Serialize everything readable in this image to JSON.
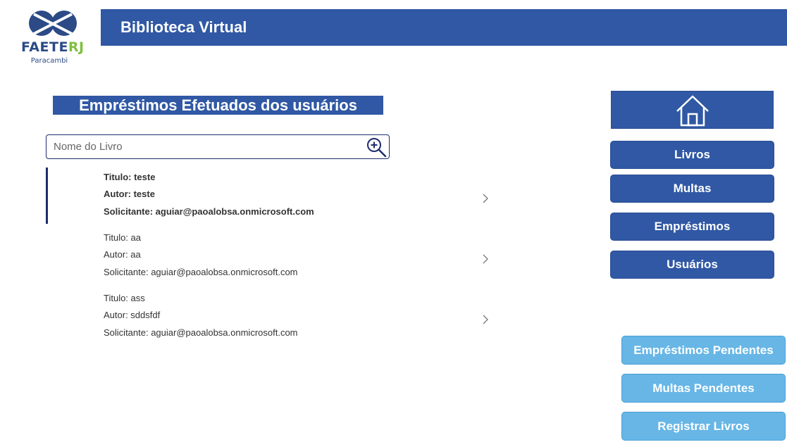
{
  "logo": {
    "name_main": "FAETE",
    "name_accent": "RJ",
    "subtitle": "Paracambi"
  },
  "header": {
    "title": "Biblioteca Virtual"
  },
  "section": {
    "title": "Empréstimos Efetuados dos usuários"
  },
  "search": {
    "placeholder": "Nome do Livro",
    "value": ""
  },
  "loans": [
    {
      "titulo": "Titulo: teste",
      "autor": "Autor: teste",
      "solicitante": "Solicitante: aguiar@paoalobsa.onmicrosoft.com",
      "selected": true
    },
    {
      "titulo": "Titulo: aa",
      "autor": "Autor: aa",
      "solicitante": "Solicitante: aguiar@paoalobsa.onmicrosoft.com",
      "selected": false
    },
    {
      "titulo": "Titulo: ass",
      "autor": "Autor: sddsfdf",
      "solicitante": "Solicitante: aguiar@paoalobsa.onmicrosoft.com",
      "selected": false
    }
  ],
  "nav": {
    "home_icon": "home-icon",
    "livros": "Livros",
    "multas": "Multas",
    "emprestimos": "Empréstimos",
    "usuarios": "Usuários"
  },
  "actions": {
    "emprestimos_pendentes": "Empréstimos Pendentes",
    "multas_pendentes": "Multas Pendentes",
    "registrar_livros": "Registrar Livros"
  },
  "colors": {
    "primary": "#3058a4",
    "light": "#67b6e6",
    "dark": "#1f2d6b",
    "accent_green": "#7fbf3f"
  }
}
